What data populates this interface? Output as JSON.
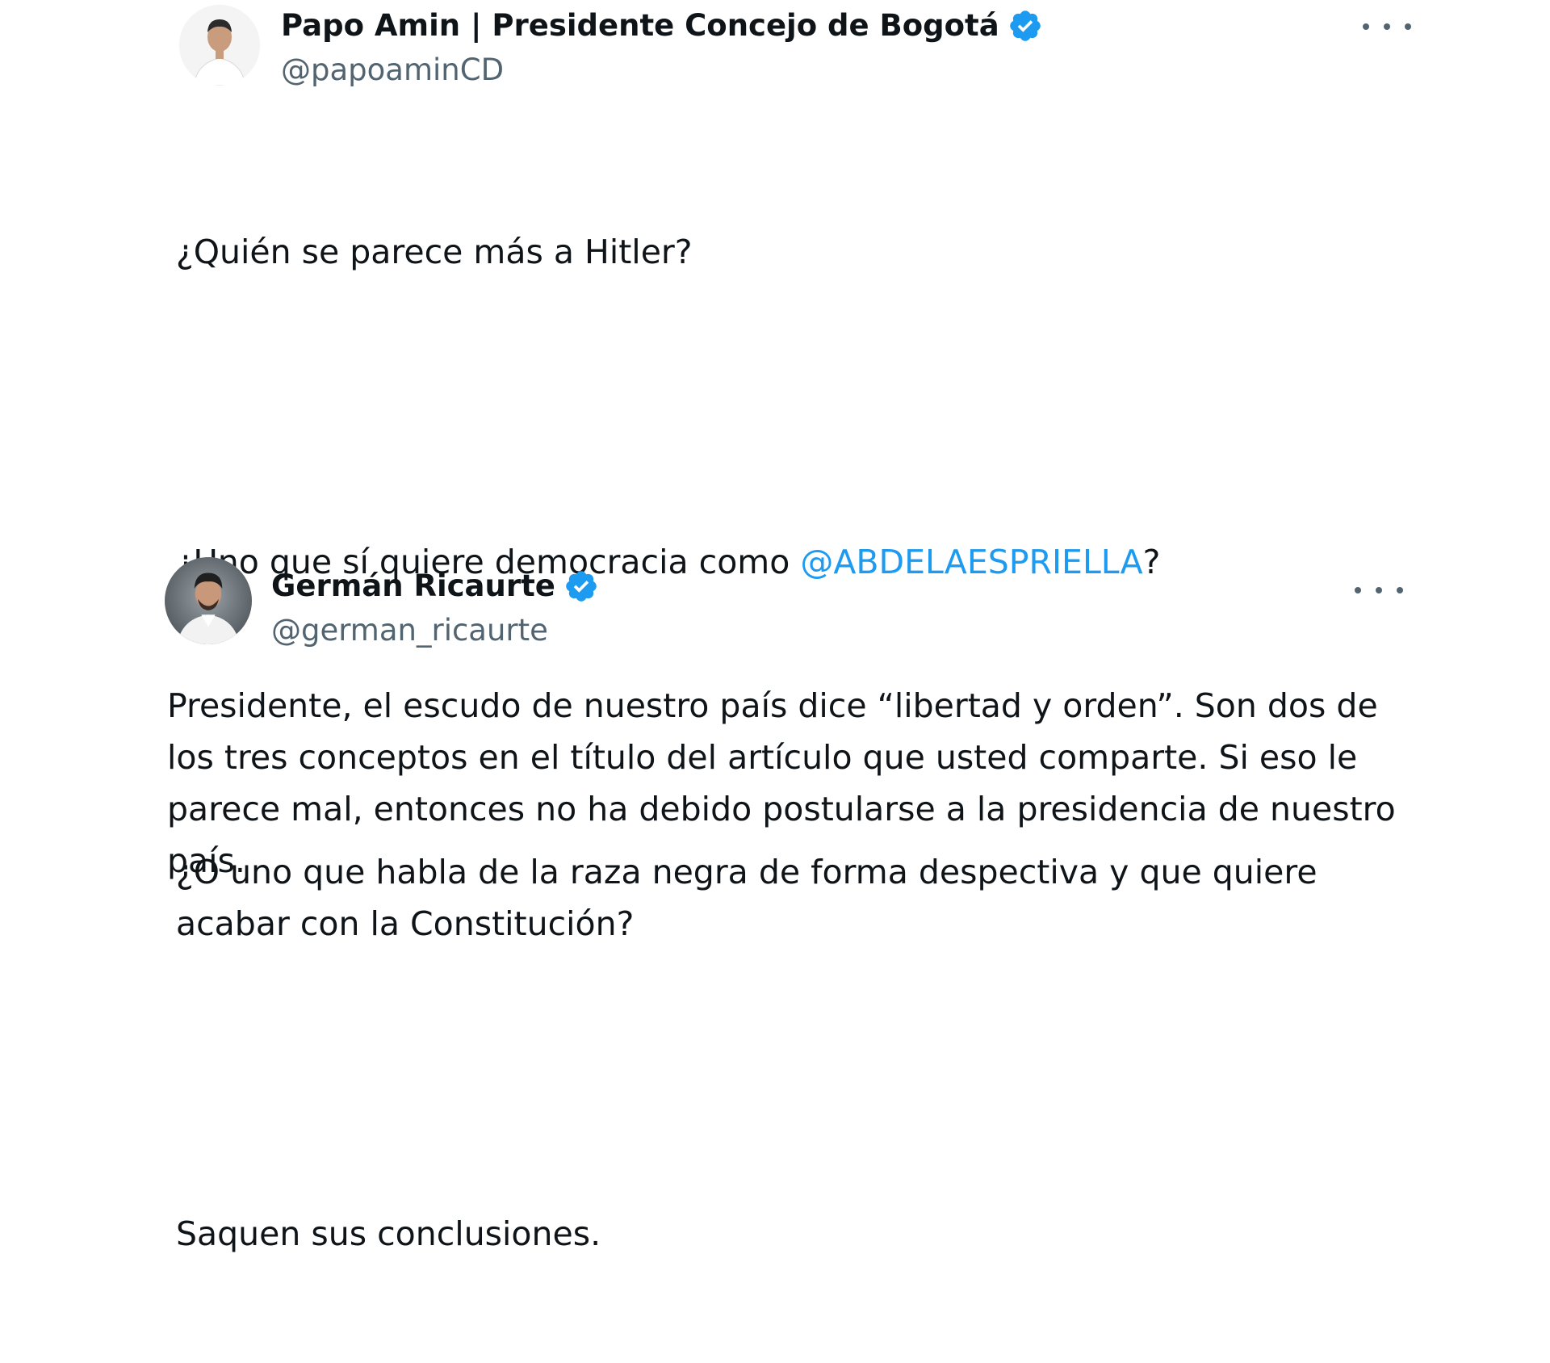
{
  "colors": {
    "text": "#0f1419",
    "secondary": "#536471",
    "link": "#1d9bf0",
    "verified": "#1d9bf0"
  },
  "tweets": [
    {
      "display_name": "Papo Amin | Presidente Concejo de Bogotá",
      "handle": "@papoaminCD",
      "verified_icon": "verified-badge-icon",
      "more_icon": "more-options-icon",
      "paragraphs": [
        "¿Quién se parece más a Hitler?",
        {
          "before": "¿Uno que sí quiere democracia como ",
          "mention": "@ABDELAESPRIELLA",
          "after": "?"
        },
        "¿O uno que habla de la raza negra de forma despectiva y que quiere acabar con la Constitución?",
        "Saquen sus conclusiones."
      ]
    },
    {
      "display_name": "Germán Ricaurte",
      "handle": "@german_ricaurte",
      "verified_icon": "verified-badge-icon",
      "more_icon": "more-options-icon",
      "body": "Presidente, el escudo de nuestro país dice “libertad y orden”. Son dos de los tres conceptos en el título del artículo que usted comparte. Si eso le parece mal, entonces no ha debido postularse a la presidencia de nuestro país."
    }
  ]
}
